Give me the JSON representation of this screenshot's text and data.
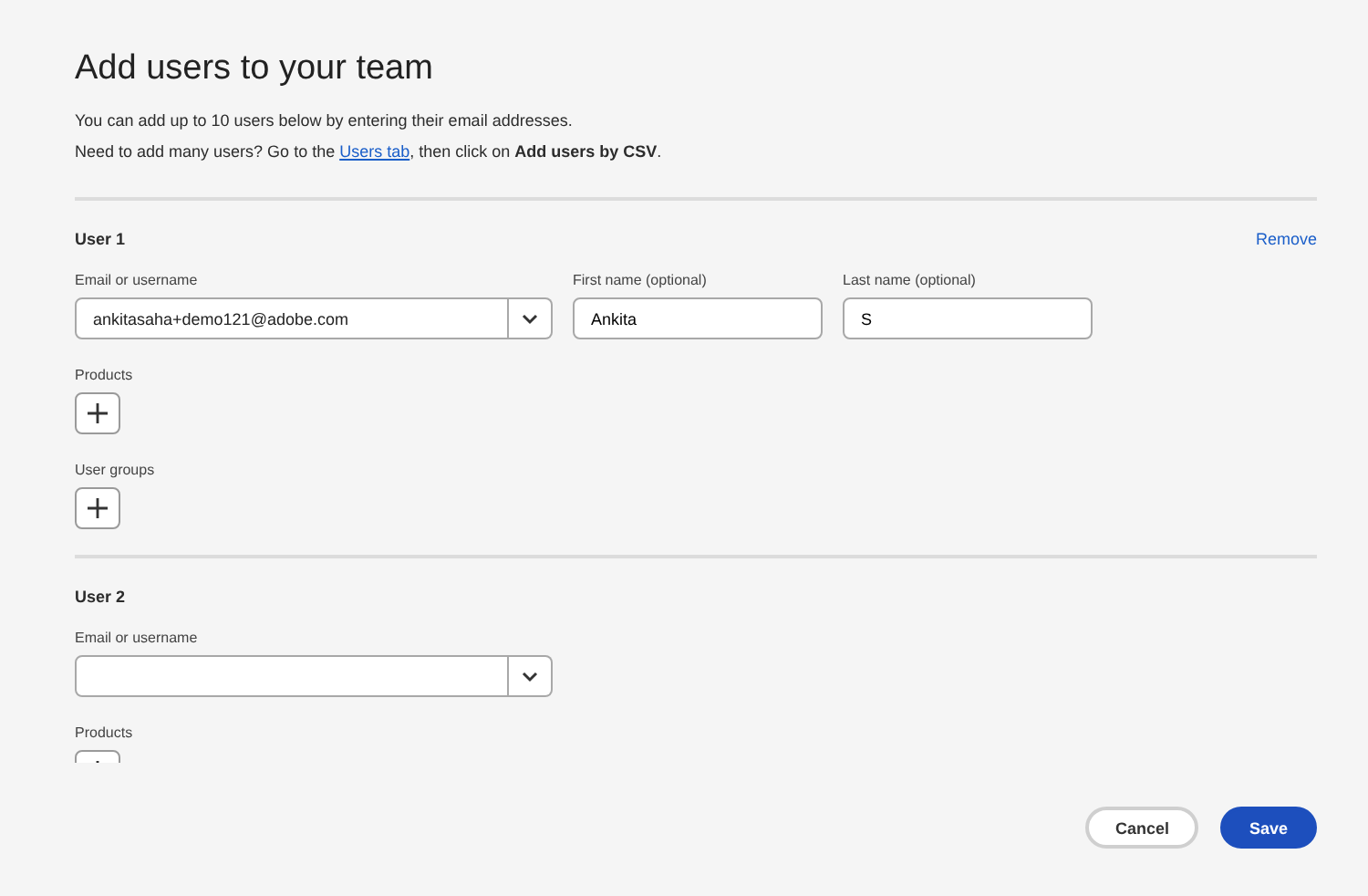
{
  "title": "Add users to your team",
  "intro": {
    "line_1": "You can add up to 10 users below by entering their email addresses.",
    "line_2_before": "Need to add many users? Go to the ",
    "link": "Users tab",
    "line_2_after": ", then click on **Add users by CSV**."
  },
  "users": [
    {
      "heading": "User 1",
      "remove": "Remove",
      "email": {
        "label": "Email or username",
        "value": "ankitasaha+demo121@adobe.com"
      },
      "first_name": {
        "label": "First name (optional)",
        "value": "Ankita"
      },
      "last_name": {
        "label": "Last name (optional)",
        "value": "S"
      },
      "products": {
        "label": "Products"
      },
      "user_groups": {
        "label": "User groups"
      }
    },
    {
      "heading": "User 2",
      "email": {
        "label": "Email or username"
      },
      "products": {
        "label": "Products"
      }
    }
  ],
  "buttons": {
    "cancel": "Cancel",
    "save": "Save"
  }
}
